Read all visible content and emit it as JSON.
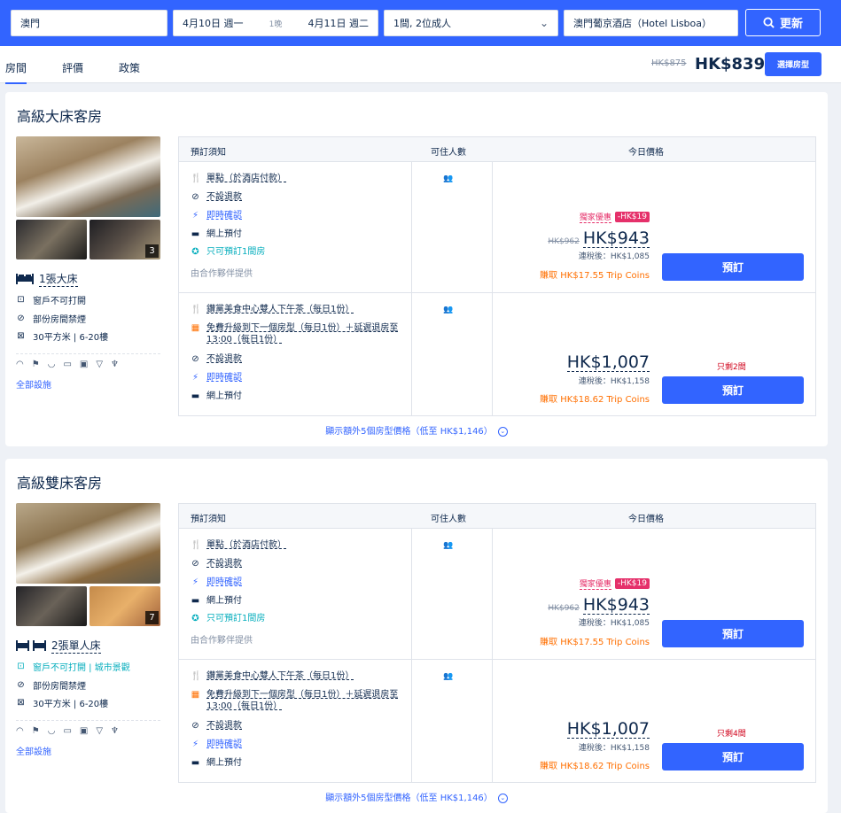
{
  "search": {
    "destination": "澳門",
    "checkin": "4月10日 週一",
    "nights": "1晚",
    "checkout": "4月11日 週二",
    "guests": "1間, 2位成人",
    "hotel": "澳門葡京酒店（Hotel Lisboa）",
    "update_label": "更新"
  },
  "tabs": [
    {
      "label": "房間"
    },
    {
      "label": "評價"
    },
    {
      "label": "政策"
    }
  ],
  "top_price": {
    "old": "HK$875",
    "new": "HK$839",
    "select_label": "選擇房型"
  },
  "rooms": [
    {
      "title": "高級大床客房",
      "photo_count": "3",
      "bed": "1張大床",
      "features": [
        "窗戶不可打開",
        "部份房間禁煙",
        "30平方米 | 6-20樓"
      ],
      "all_facilities": "全部設施",
      "table_headers": {
        "policy": "預訂須知",
        "occupancy": "可住人數",
        "price": "今日價格"
      },
      "rates": [
        {
          "policies": [
            {
              "icon": "meal-icon",
              "text": "單點（於酒店付款）"
            },
            {
              "icon": "no-refund-icon",
              "text": "不設退款"
            },
            {
              "icon": "instant-confirm-icon",
              "text": "即時確認"
            },
            {
              "icon": "card-icon",
              "text": "網上預付"
            },
            {
              "icon": "limit-icon",
              "text": "只可預訂1間房"
            }
          ],
          "partner": "由合作夥伴提供",
          "promo_label": "獨家優惠",
          "promo_tag": "-HK$19",
          "old_price": "HK$962",
          "price": "HK$943",
          "tax": "連稅後：HK$1,085",
          "coins": "賺取 HK$17.55 Trip Coins",
          "book_label": "預訂"
        },
        {
          "policies": [
            {
              "icon": "meal-icon",
              "text": "鑽黨美食中心雙人下午茶（每日1份）"
            },
            {
              "icon": "upgrade-icon",
              "text": "免費升級到下一個房型（每日1份）＋延遲退房至13:00（每日1份）"
            },
            {
              "icon": "no-refund-icon",
              "text": "不設退款"
            },
            {
              "icon": "instant-confirm-icon",
              "text": "即時確認"
            },
            {
              "icon": "card-icon",
              "text": "網上預付"
            }
          ],
          "left": "只剩2間",
          "price": "HK$1,007",
          "tax": "連稅後：HK$1,158",
          "coins": "賺取 HK$18.62 Trip Coins",
          "book_label": "預訂"
        }
      ],
      "more": "顯示額外5個房型價格（低至 HK$1,146）"
    },
    {
      "title": "高級雙床客房",
      "photo_count": "7",
      "bed": "2張單人床",
      "features": [
        "窗戶不可打開 | 城市景觀",
        "部份房間禁煙",
        "30平方米 | 6-20樓"
      ],
      "all_facilities": "全部設施",
      "table_headers": {
        "policy": "預訂須知",
        "occupancy": "可住人數",
        "price": "今日價格"
      },
      "rates": [
        {
          "policies": [
            {
              "icon": "meal-icon",
              "text": "單點（於酒店付款）"
            },
            {
              "icon": "no-refund-icon",
              "text": "不設退款"
            },
            {
              "icon": "instant-confirm-icon",
              "text": "即時確認"
            },
            {
              "icon": "card-icon",
              "text": "網上預付"
            },
            {
              "icon": "limit-icon",
              "text": "只可預訂1間房"
            }
          ],
          "partner": "由合作夥伴提供",
          "promo_label": "獨家優惠",
          "promo_tag": "-HK$19",
          "old_price": "HK$962",
          "price": "HK$943",
          "tax": "連稅後：HK$1,085",
          "coins": "賺取 HK$17.55 Trip Coins",
          "book_label": "預訂"
        },
        {
          "policies": [
            {
              "icon": "meal-icon",
              "text": "鑽黨美食中心雙人下午茶（每日1份）"
            },
            {
              "icon": "upgrade-icon",
              "text": "免費升級到下一個房型（每日1份）＋延遲退房至13:00（每日1份）"
            },
            {
              "icon": "no-refund-icon",
              "text": "不設退款"
            },
            {
              "icon": "instant-confirm-icon",
              "text": "即時確認"
            },
            {
              "icon": "card-icon",
              "text": "網上預付"
            }
          ],
          "left": "只剩4間",
          "price": "HK$1,007",
          "tax": "連稅後：HK$1,158",
          "coins": "賺取 HK$18.62 Trip Coins",
          "book_label": "預訂"
        }
      ],
      "more": "顯示額外5個房型價格（低至 HK$1,146）"
    }
  ]
}
